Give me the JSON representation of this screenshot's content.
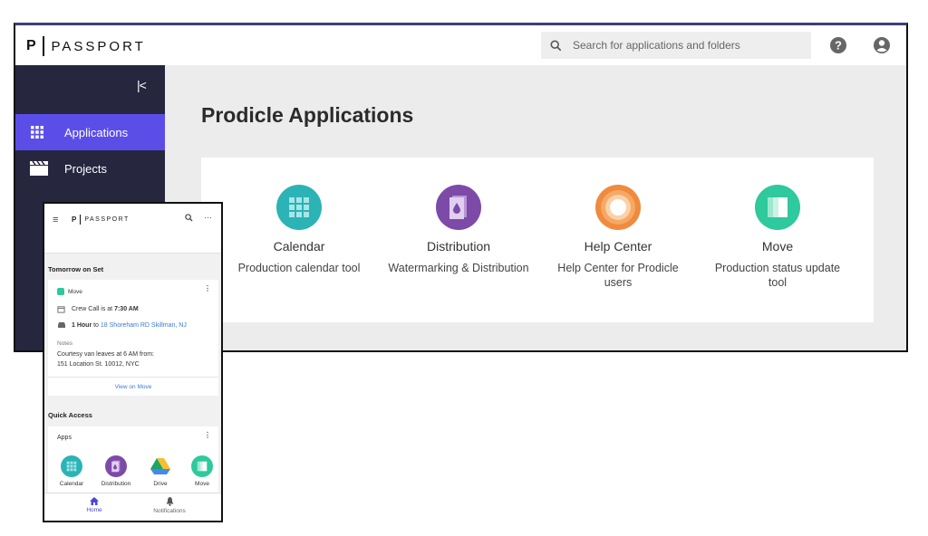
{
  "brand": {
    "letter": "P",
    "word": "PASSPORT"
  },
  "header": {
    "search_placeholder": "Search for applications and folders"
  },
  "icons": {
    "search": "search-icon",
    "help": "help-icon",
    "user": "account-icon",
    "collapse": "collapse-sidebar-icon",
    "applications": "apps-grid-icon",
    "projects": "clapperboard-icon"
  },
  "sidebar": {
    "collapse_label": "|<",
    "items": [
      {
        "label": "Applications",
        "active": true
      },
      {
        "label": "Projects",
        "active": false
      }
    ]
  },
  "main": {
    "title": "Prodicle Applications",
    "apps": [
      {
        "name": "Calendar",
        "desc": "Production calendar tool",
        "color": "#2bb3b6"
      },
      {
        "name": "Distribution",
        "desc": "Watermarking & Distribution",
        "color": "#7d4aa8"
      },
      {
        "name": "Help Center",
        "desc": "Help Center for Prodicle users",
        "color": "#f08a3e"
      },
      {
        "name": "Move",
        "desc": "Production status update tool",
        "color": "#2ec99c"
      }
    ]
  },
  "mobile": {
    "menu_icon": "≡",
    "more_icon": "···",
    "tomorrow": {
      "heading": "Tomorrow on Set",
      "app_label": "Move",
      "crew_call_prefix": "Crew Call is at ",
      "crew_call_time": "7:30 AM",
      "travel_prefix": "1 Hour",
      "travel_to": " to ",
      "address": "18 Shoreham RD Skillman, NJ",
      "notes_label": "Notes",
      "notes_line1": "Courtesy van leaves at 6 AM from:",
      "notes_line2": "151 Location St. 10012, NYC",
      "view_link": "View on Move"
    },
    "quick_access": {
      "heading": "Quick Access",
      "apps_label": "Apps",
      "apps": [
        "Calendar",
        "Distribution",
        "Drive",
        "Move"
      ]
    },
    "bottom_nav": [
      {
        "label": "Home",
        "active": true
      },
      {
        "label": "Notifications",
        "active": false
      }
    ]
  },
  "colors": {
    "accent": "#5b4ee8",
    "sidebar": "#27263f",
    "link": "#3a7bd5"
  }
}
